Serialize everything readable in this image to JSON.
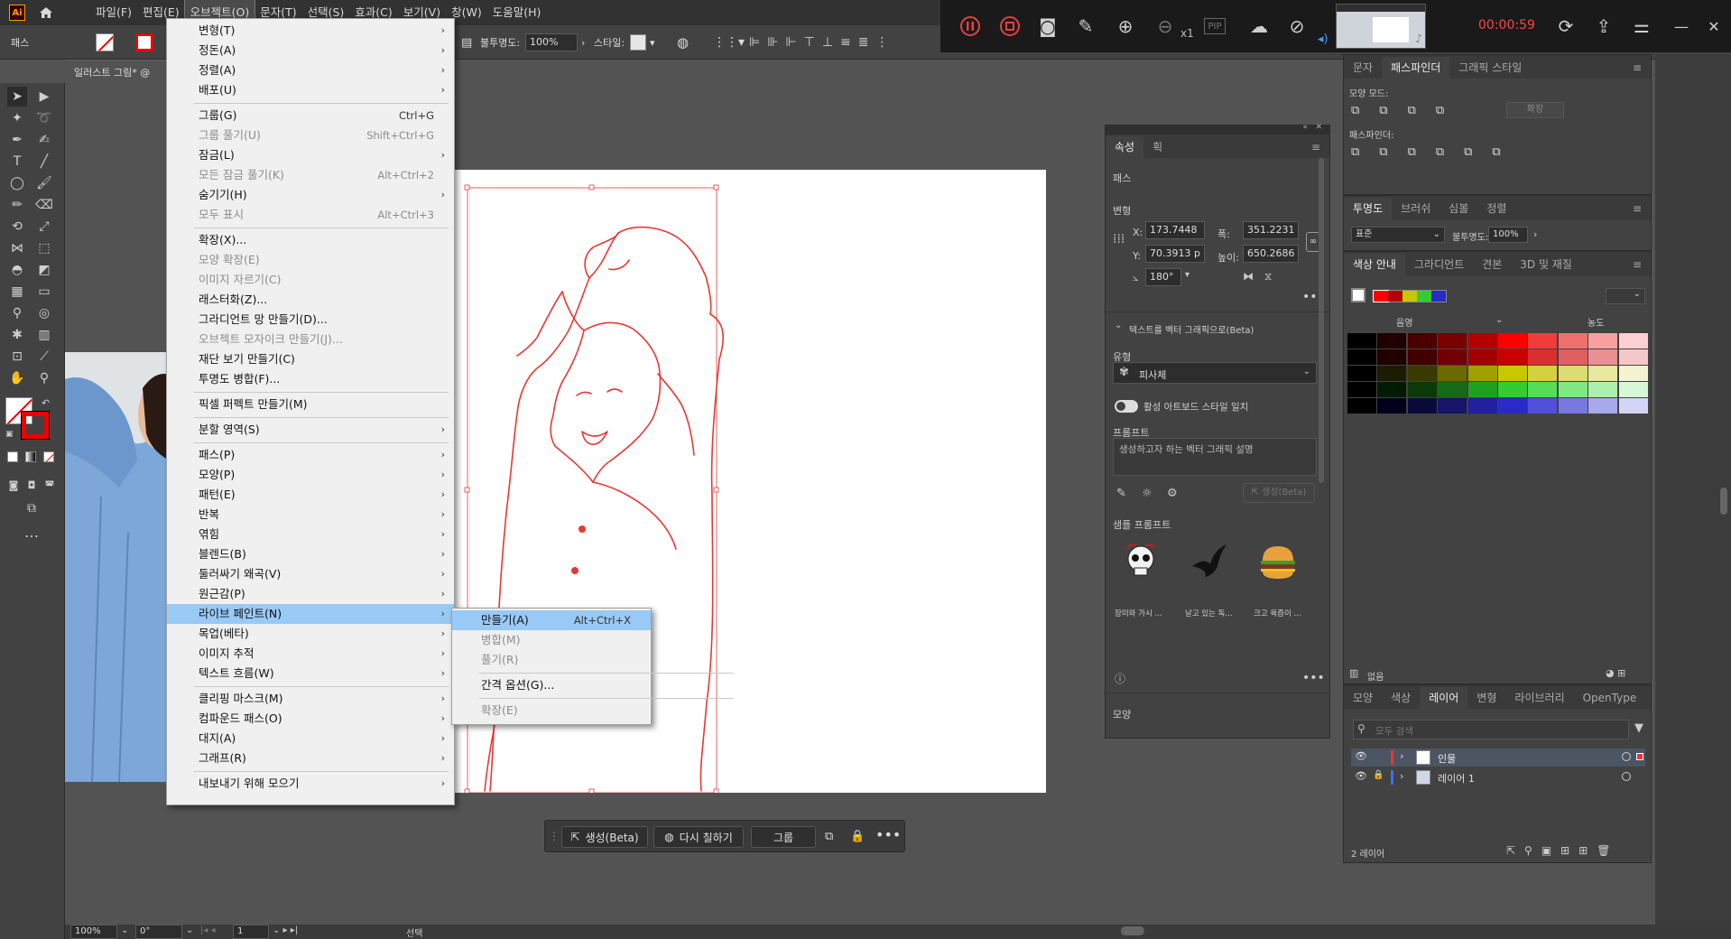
{
  "app": {
    "logo": "Ai"
  },
  "menubar": [
    {
      "label": "파일(F)"
    },
    {
      "label": "편집(E)"
    },
    {
      "label": "오브젝트(O)"
    },
    {
      "label": "문자(T)"
    },
    {
      "label": "선택(S)"
    },
    {
      "label": "효과(C)"
    },
    {
      "label": "보기(V)"
    },
    {
      "label": "창(W)"
    },
    {
      "label": "도움말(H)"
    }
  ],
  "controlbar": {
    "path_label": "패스",
    "opacity_label": "불투명도:",
    "opacity_value": "100%",
    "style_label": "스타일:"
  },
  "recorder": {
    "zoom": "x1",
    "pip": "PIP",
    "timer": "00:00:59"
  },
  "doc_tab": {
    "title": "일러스트 그림* @"
  },
  "object_menu": [
    {
      "label": "변형(T)",
      "arrow": true
    },
    {
      "label": "정돈(A)",
      "arrow": true
    },
    {
      "label": "정렬(A)",
      "arrow": true
    },
    {
      "label": "배포(U)",
      "arrow": true
    },
    {
      "sep": true
    },
    {
      "label": "그룹(G)",
      "shortcut": "Ctrl+G"
    },
    {
      "label": "그룹 풀기(U)",
      "shortcut": "Shift+Ctrl+G",
      "disabled": true
    },
    {
      "label": "잠금(L)",
      "arrow": true
    },
    {
      "label": "모든 잠금 풀기(K)",
      "shortcut": "Alt+Ctrl+2",
      "disabled": true
    },
    {
      "label": "숨기기(H)",
      "arrow": true
    },
    {
      "label": "모두 표시",
      "shortcut": "Alt+Ctrl+3",
      "disabled": true
    },
    {
      "sep": true
    },
    {
      "label": "확장(X)..."
    },
    {
      "label": "모양 확장(E)",
      "disabled": true
    },
    {
      "label": "이미지 자르기(C)",
      "disabled": true
    },
    {
      "label": "래스터화(Z)..."
    },
    {
      "label": "그라디언트 망 만들기(D)..."
    },
    {
      "label": "오브젝트 모자이크 만들기(J)...",
      "disabled": true
    },
    {
      "label": "재단 보기 만들기(C)"
    },
    {
      "label": "투명도 병합(F)..."
    },
    {
      "sep": true
    },
    {
      "label": "픽셀 퍼펙트 만들기(M)"
    },
    {
      "sep": true
    },
    {
      "label": "분할 영역(S)",
      "arrow": true
    },
    {
      "sep": true
    },
    {
      "label": "패스(P)",
      "arrow": true
    },
    {
      "label": "모양(P)",
      "arrow": true
    },
    {
      "label": "패턴(E)",
      "arrow": true
    },
    {
      "label": "반복",
      "arrow": true
    },
    {
      "label": "엮힘",
      "arrow": true
    },
    {
      "label": "블렌드(B)",
      "arrow": true
    },
    {
      "label": "둘러싸기 왜곡(V)",
      "arrow": true
    },
    {
      "label": "원근감(P)",
      "arrow": true
    },
    {
      "label": "라이브 페인트(N)",
      "arrow": true,
      "selected": true
    },
    {
      "label": "목업(베타)",
      "arrow": true
    },
    {
      "label": "이미지 추적",
      "arrow": true
    },
    {
      "label": "텍스트 흐름(W)",
      "arrow": true
    },
    {
      "sep": true
    },
    {
      "label": "클리핑 마스크(M)",
      "arrow": true
    },
    {
      "label": "컴파운드 패스(O)",
      "arrow": true
    },
    {
      "label": "대지(A)",
      "arrow": true
    },
    {
      "label": "그래프(R)",
      "arrow": true
    },
    {
      "sep": true
    },
    {
      "label": "내보내기 위해 모으기",
      "arrow": true
    }
  ],
  "live_paint_submenu": [
    {
      "label": "만들기(A)",
      "shortcut": "Alt+Ctrl+X",
      "selected": true
    },
    {
      "label": "병합(M)",
      "disabled": true
    },
    {
      "label": "풀기(R)",
      "disabled": true
    },
    {
      "sep": true
    },
    {
      "label": "간격 옵션(G)..."
    },
    {
      "sep": true
    },
    {
      "label": "확장(E)",
      "disabled": true
    }
  ],
  "taskbar": {
    "generate": "생성(Beta)",
    "recolor": "다시 칠하기",
    "group": "그룹"
  },
  "properties": {
    "tabs": [
      "속성",
      "획"
    ],
    "section_path": "패스",
    "transform_label": "변형",
    "x_label": "X:",
    "x": "173.7448",
    "y_label": "Y:",
    "y": "70.3913 p",
    "w_label": "폭:",
    "w": "351.2231",
    "h_label": "높이:",
    "h": "650.2686",
    "angle": "180°",
    "text_to_vector": "텍스트를 벡터 그래픽으로(Beta)",
    "type_label": "유형",
    "subject": "피사체",
    "match_style": "활성 아트보드 스타일 일치",
    "prompt_label": "프롬프트",
    "prompt_placeholder": "생성하고자 하는 벡터 그래픽 설명",
    "generate_btn": "생성(Beta)",
    "samples_label": "샘플 프롬프트",
    "samples": [
      "장미와 가시 ...",
      "날고 있는 독...",
      "크고 육즙이 ..."
    ],
    "appearance_label": "모양"
  },
  "pathfinder": {
    "tabs": [
      "문자",
      "패스파인더",
      "그래픽 스타일"
    ],
    "shape_modes": "모양 모드:",
    "expand": "확장",
    "pathfinders": "패스파인더:"
  },
  "transparency": {
    "tabs": [
      "투명도",
      "브러쉬",
      "심볼",
      "정렬"
    ],
    "mode": "표준",
    "opacity_label": "불투명도:",
    "opacity": "100%"
  },
  "color_guide": {
    "tabs": [
      "색상 안내",
      "그라디언트",
      "견본",
      "3D 및 재질"
    ],
    "harmony": [
      "#ff0000",
      "#b30000",
      "#c8c800",
      "#33cc33",
      "#2a2ac8"
    ],
    "tint": "음영",
    "shade": "농도",
    "none": "없음",
    "grid": [
      [
        "#000000",
        "#200000",
        "#4a0000",
        "#7a0000",
        "#b30000",
        "#ff0000",
        "#f03c3c",
        "#f07070",
        "#f6a0a0",
        "#fcd0d0"
      ],
      [
        "#000000",
        "#200000",
        "#400000",
        "#700000",
        "#a00000",
        "#c80000",
        "#d83030",
        "#e06060",
        "#ea9090",
        "#f4c8c8"
      ],
      [
        "#000000",
        "#1c1c00",
        "#3a3a00",
        "#6a6a00",
        "#a0a000",
        "#c8c800",
        "#d4d040",
        "#dcdc70",
        "#e8e8a0",
        "#f4f4d0"
      ],
      [
        "#000000",
        "#001c00",
        "#0a3a0a",
        "#156a15",
        "#20a020",
        "#33cc33",
        "#55dd55",
        "#80e880",
        "#acf0ac",
        "#d6f8d6"
      ],
      [
        "#000000",
        "#00001c",
        "#0a0a3a",
        "#15156a",
        "#2020a0",
        "#2a2ac8",
        "#5050d8",
        "#7878e0",
        "#a8a8ec",
        "#d4d4f6"
      ]
    ]
  },
  "layers": {
    "tabs": [
      "모양",
      "색상",
      "레이어",
      "변형",
      "라이브러리",
      "OpenType"
    ],
    "search_placeholder": "모두 검색",
    "items": [
      {
        "name": "인물",
        "color": "#e53935"
      },
      {
        "name": "레이어 1",
        "color": "#3f6cff"
      }
    ],
    "count": "2 레이어"
  },
  "status": {
    "zoom": "100%",
    "angle": "0°",
    "page": "1",
    "tool": "선택"
  }
}
